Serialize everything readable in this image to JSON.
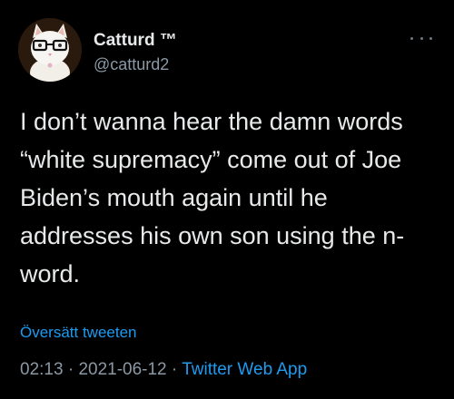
{
  "author": {
    "display_name": "Catturd ™",
    "handle": "@catturd2",
    "avatar_icon": "cat-with-glasses-avatar"
  },
  "more_icon": "more-options-icon",
  "tweet": {
    "lines": [
      "I don’t wanna hear the damn words",
      "“white supremacy” come out of Joe",
      "Biden’s mouth again until he",
      "addresses his own son using the n-",
      "word."
    ]
  },
  "translate_label": "Översätt tweeten",
  "meta": {
    "time": "02:13",
    "sep1": " · ",
    "date": "2021-06-12",
    "sep2": " · ",
    "source": "Twitter Web App"
  },
  "colors": {
    "background": "#000000",
    "text": "#e7e9ea",
    "secondary": "#8b98a5",
    "link": "#1d9bf0"
  }
}
